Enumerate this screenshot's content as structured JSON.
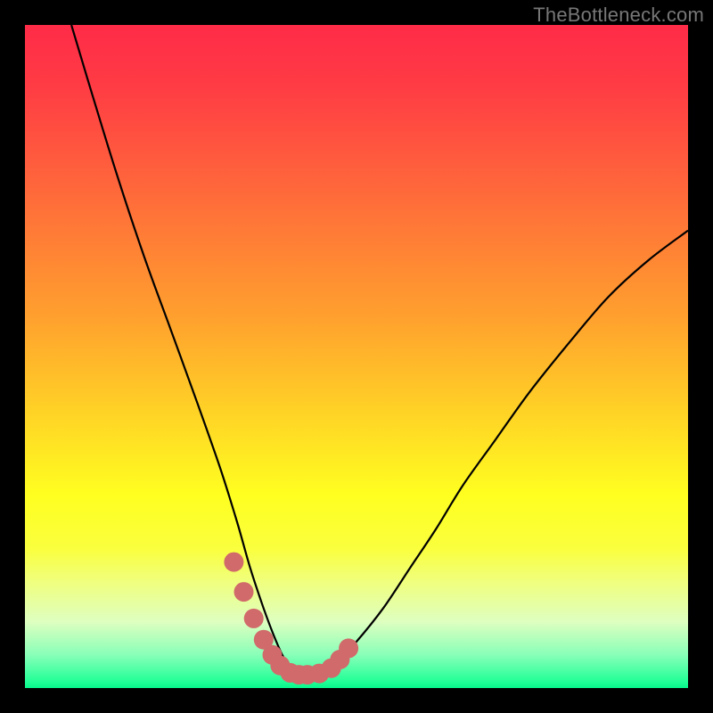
{
  "watermark": "TheBottleneck.com",
  "chart_data": {
    "type": "line",
    "title": "",
    "xlabel": "",
    "ylabel": "",
    "xlim": [
      0,
      100
    ],
    "ylim": [
      0,
      100
    ],
    "series": [
      {
        "name": "curve",
        "color": "#000000",
        "x": [
          7,
          10,
          14,
          18,
          22,
          26,
          29.5,
          32,
          34,
          36,
          37.5,
          38.8,
          40,
          41,
          42,
          45,
          47,
          50,
          54,
          58,
          62,
          66,
          71,
          76,
          82,
          88,
          94,
          100
        ],
        "y": [
          100,
          90,
          77,
          65,
          54,
          43,
          33,
          25,
          18,
          12,
          8,
          5,
          3,
          2,
          1.8,
          2.2,
          3.8,
          7,
          12,
          18,
          24,
          30.5,
          37.5,
          44.5,
          52,
          59,
          64.5,
          69
        ]
      },
      {
        "name": "marker-dots",
        "color": "#d16a6a",
        "x": [
          31.5,
          33,
          34.5,
          36,
          37.3,
          38.5,
          40,
          41.3,
          42.6,
          44.4,
          46.2,
          47.5,
          48.8
        ],
        "y": [
          19,
          14.5,
          10.5,
          7.3,
          5,
          3.4,
          2.3,
          2.0,
          2.0,
          2.2,
          3.0,
          4.3,
          6.0
        ]
      }
    ],
    "gradient_colors": {
      "top": "#ff2b48",
      "mid": "#ffff20",
      "bottom": "#06f78c"
    }
  }
}
